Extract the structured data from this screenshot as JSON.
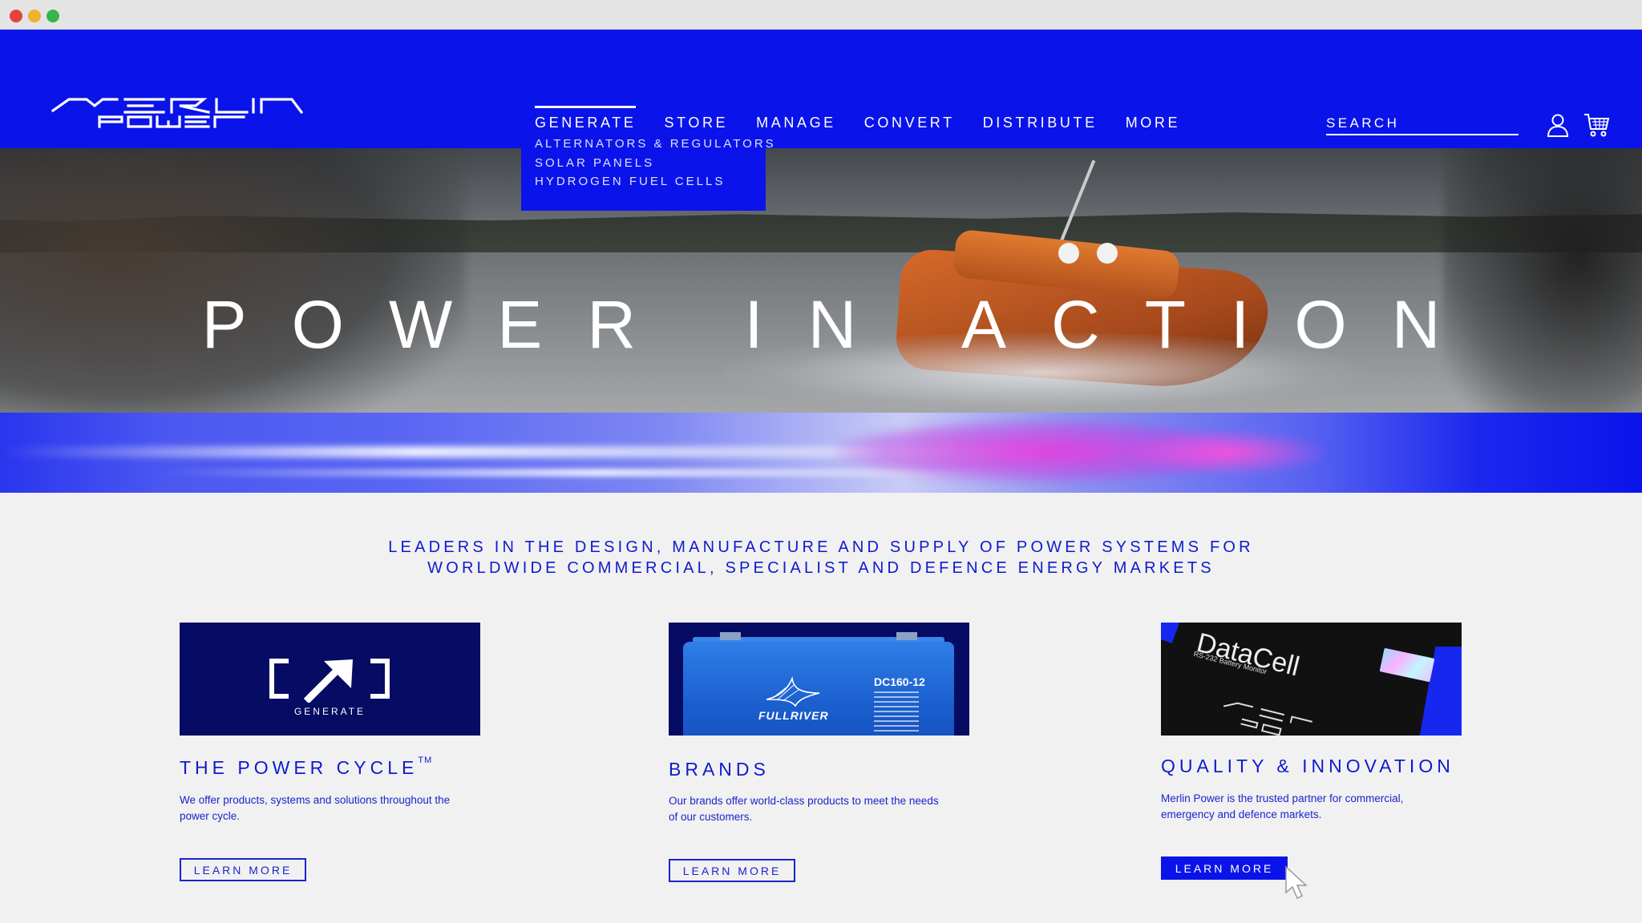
{
  "header": {
    "logo_alt": "Merlin Power",
    "nav": [
      {
        "label": "GENERATE",
        "active": true
      },
      {
        "label": "STORE",
        "active": false
      },
      {
        "label": "MANAGE",
        "active": false
      },
      {
        "label": "CONVERT",
        "active": false
      },
      {
        "label": "DISTRIBUTE",
        "active": false
      },
      {
        "label": "MORE",
        "active": false
      }
    ],
    "search_placeholder": "SEARCH",
    "icons": [
      "user-icon",
      "cart-icon"
    ]
  },
  "dropdown": {
    "items": [
      "ALTERNATORS & REGULATORS",
      "SOLAR PANELS",
      "HYDROGEN FUEL CELLS"
    ]
  },
  "hero": {
    "title": "POWER IN ACTION"
  },
  "intro": {
    "line1": "LEADERS IN THE DESIGN, MANUFACTURE AND SUPPLY OF POWER SYSTEMS FOR",
    "line2": "WORLDWIDE COMMERCIAL, SPECIALIST AND DEFENCE ENERGY MARKETS"
  },
  "cards": [
    {
      "title": "THE POWER CYCLE",
      "title_sup": "TM",
      "image_label": "GENERATE",
      "text": "We offer products, systems and solutions throughout the power cycle.",
      "button": "LEARN MORE"
    },
    {
      "title": "BRANDS",
      "image_brand": "FULLRIVER",
      "image_model": "DC160-12",
      "text": "Our brands offer world-class products to meet the needs of our customers.",
      "button": "LEARN MORE"
    },
    {
      "title": "QUALITY & INNOVATION",
      "image_product": "DataCell",
      "image_product_sub": "RS-232 Battery Monitor",
      "text": "Merlin Power is the trusted partner for commercial, emergency and defence markets.",
      "button": "LEARN MORE"
    }
  ],
  "colors": {
    "brand_blue": "#0a14ea",
    "text_blue": "#0e1bcf",
    "dark_navy": "#060c63",
    "page_bg": "#f1f1f1"
  }
}
